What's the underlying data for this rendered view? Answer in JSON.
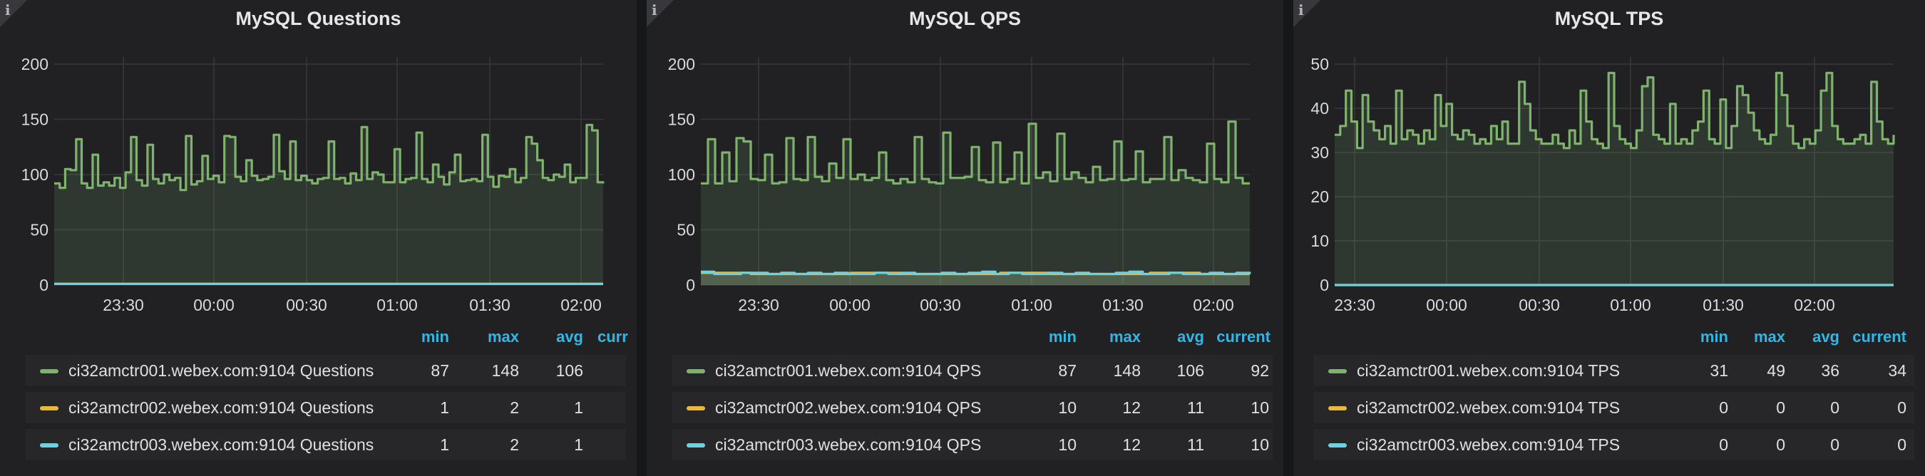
{
  "panels": [
    {
      "title": "MySQL Questions",
      "info_icon": "i",
      "legend_columns": [
        "min",
        "max",
        "avg",
        "curr"
      ],
      "legend": [
        {
          "name": "ci32amctr001.webex.com:9104 Questions",
          "color": "#7eb26d",
          "min": "87",
          "max": "148",
          "avg": "106",
          "current": ""
        },
        {
          "name": "ci32amctr002.webex.com:9104 Questions",
          "color": "#eab839",
          "min": "1",
          "max": "2",
          "avg": "1",
          "current": ""
        },
        {
          "name": "ci32amctr003.webex.com:9104 Questions",
          "color": "#6ed0e0",
          "min": "1",
          "max": "2",
          "avg": "1",
          "current": ""
        }
      ]
    },
    {
      "title": "MySQL QPS",
      "info_icon": "i",
      "legend_columns": [
        "min",
        "max",
        "avg",
        "current"
      ],
      "legend": [
        {
          "name": "ci32amctr001.webex.com:9104 QPS",
          "color": "#7eb26d",
          "min": "87",
          "max": "148",
          "avg": "106",
          "current": "92"
        },
        {
          "name": "ci32amctr002.webex.com:9104 QPS",
          "color": "#eab839",
          "min": "10",
          "max": "12",
          "avg": "11",
          "current": "10"
        },
        {
          "name": "ci32amctr003.webex.com:9104 QPS",
          "color": "#6ed0e0",
          "min": "10",
          "max": "12",
          "avg": "11",
          "current": "10"
        }
      ]
    },
    {
      "title": "MySQL TPS",
      "info_icon": "i",
      "legend_columns": [
        "min",
        "max",
        "avg",
        "current"
      ],
      "legend": [
        {
          "name": "ci32amctr001.webex.com:9104 TPS",
          "color": "#7eb26d",
          "min": "31",
          "max": "49",
          "avg": "36",
          "current": "34"
        },
        {
          "name": "ci32amctr002.webex.com:9104 TPS",
          "color": "#eab839",
          "min": "0",
          "max": "0",
          "avg": "0",
          "current": "0"
        },
        {
          "name": "ci32amctr003.webex.com:9104 TPS",
          "color": "#6ed0e0",
          "min": "0",
          "max": "0",
          "avg": "0",
          "current": "0"
        }
      ]
    }
  ],
  "chart_data": [
    {
      "type": "area",
      "title": "MySQL Questions",
      "x_ticks": [
        "23:30",
        "00:00",
        "00:30",
        "01:00",
        "01:30",
        "02:00"
      ],
      "y_ticks": [
        "0",
        "50",
        "100",
        "150",
        "200"
      ],
      "ylim": [
        0,
        200
      ],
      "grid": true,
      "series": [
        {
          "name": "ci32amctr001.webex.com:9104 Questions",
          "color": "#7eb26d",
          "values": [
            92,
            88,
            105,
            104,
            132,
            92,
            88,
            118,
            90,
            93,
            90,
            97,
            88,
            102,
            134,
            95,
            90,
            127,
            96,
            92,
            100,
            95,
            97,
            86,
            135,
            91,
            94,
            117,
            96,
            99,
            93,
            135,
            134,
            98,
            94,
            113,
            99,
            95,
            96,
            98,
            136,
            103,
            96,
            130,
            95,
            99,
            95,
            92,
            96,
            97,
            130,
            96,
            97,
            92,
            101,
            95,
            143,
            96,
            102,
            100,
            93,
            93,
            123,
            93,
            96,
            97,
            138,
            96,
            93,
            109,
            98,
            91,
            102,
            118,
            94,
            95,
            96,
            94,
            136,
            98,
            89,
            99,
            98,
            105,
            93,
            97,
            134,
            128,
            113,
            97,
            95,
            100,
            98,
            109,
            93,
            97,
            97,
            145,
            140,
            93,
            92
          ]
        },
        {
          "name": "ci32amctr002.webex.com:9104 Questions",
          "color": "#eab839",
          "values": [
            1,
            1,
            1,
            1,
            1,
            1,
            1,
            1,
            1,
            1
          ]
        },
        {
          "name": "ci32amctr003.webex.com:9104 Questions",
          "color": "#6ed0e0",
          "values": [
            1,
            1,
            1,
            1,
            1,
            1,
            1,
            1,
            1,
            1
          ]
        }
      ]
    },
    {
      "type": "area",
      "title": "MySQL QPS",
      "x_ticks": [
        "23:30",
        "00:00",
        "00:30",
        "01:00",
        "01:30",
        "02:00"
      ],
      "y_ticks": [
        "0",
        "50",
        "100",
        "150",
        "200"
      ],
      "ylim": [
        0,
        200
      ],
      "grid": true,
      "series": [
        {
          "name": "ci32amctr001.webex.com:9104 QPS",
          "color": "#7eb26d",
          "values": [
            92,
            132,
            92,
            120,
            94,
            133,
            130,
            96,
            95,
            118,
            92,
            93,
            133,
            96,
            95,
            134,
            98,
            94,
            110,
            97,
            132,
            96,
            100,
            95,
            97,
            120,
            95,
            92,
            96,
            93,
            134,
            96,
            93,
            92,
            138,
            97,
            97,
            98,
            125,
            95,
            93,
            129,
            93,
            96,
            120,
            92,
            146,
            97,
            102,
            94,
            137,
            96,
            102,
            97,
            93,
            107,
            95,
            96,
            130,
            95,
            96,
            121,
            93,
            96,
            96,
            134,
            95,
            104,
            97,
            95,
            93,
            128,
            96,
            93,
            148,
            97,
            92,
            92
          ]
        },
        {
          "name": "ci32amctr002.webex.com:9104 QPS",
          "color": "#eab839",
          "values": [
            11,
            10,
            10,
            11,
            10,
            10,
            11,
            10,
            10,
            11,
            10,
            10
          ]
        },
        {
          "name": "ci32amctr003.webex.com:9104 QPS",
          "color": "#6ed0e0",
          "values": [
            12,
            10,
            10,
            11,
            11,
            10,
            11,
            10,
            11,
            10,
            11,
            10,
            10,
            11,
            10,
            11,
            10,
            10,
            11,
            10,
            11,
            12,
            10,
            11,
            10,
            10,
            11,
            10,
            11,
            10,
            10,
            11,
            12,
            10,
            10,
            11,
            10,
            10,
            11,
            10,
            11,
            10
          ]
        }
      ]
    },
    {
      "type": "area",
      "title": "MySQL TPS",
      "x_ticks": [
        "23:30",
        "00:00",
        "00:30",
        "01:00",
        "01:30",
        "02:00"
      ],
      "y_ticks": [
        "0",
        "10",
        "20",
        "30",
        "40",
        "50"
      ],
      "ylim": [
        0,
        50
      ],
      "grid": true,
      "series": [
        {
          "name": "ci32amctr001.webex.com:9104 TPS",
          "color": "#7eb26d",
          "values": [
            34,
            36,
            44,
            37,
            31,
            43,
            37,
            35,
            33,
            36,
            32,
            44,
            33,
            35,
            34,
            32,
            35,
            33,
            43,
            36,
            41,
            34,
            33,
            35,
            34,
            32,
            33,
            32,
            36,
            33,
            37,
            32,
            32,
            46,
            41,
            35,
            33,
            32,
            32,
            34,
            32,
            31,
            35,
            32,
            44,
            37,
            33,
            32,
            31,
            48,
            36,
            33,
            32,
            31,
            35,
            45,
            47,
            34,
            33,
            32,
            41,
            32,
            33,
            32,
            35,
            37,
            44,
            33,
            32,
            42,
            31,
            36,
            45,
            43,
            39,
            35,
            33,
            32,
            34,
            48,
            43,
            36,
            32,
            31,
            33,
            32,
            35,
            44,
            48,
            36,
            33,
            32,
            32,
            33,
            34,
            32,
            46,
            37,
            33,
            32,
            34
          ]
        },
        {
          "name": "ci32amctr002.webex.com:9104 TPS",
          "color": "#eab839",
          "values": [
            0,
            0,
            0,
            0,
            0,
            0,
            0,
            0,
            0,
            0
          ]
        },
        {
          "name": "ci32amctr003.webex.com:9104 TPS",
          "color": "#6ed0e0",
          "values": [
            0,
            0,
            0,
            0,
            0,
            0,
            0,
            0,
            0,
            0
          ]
        }
      ]
    }
  ]
}
